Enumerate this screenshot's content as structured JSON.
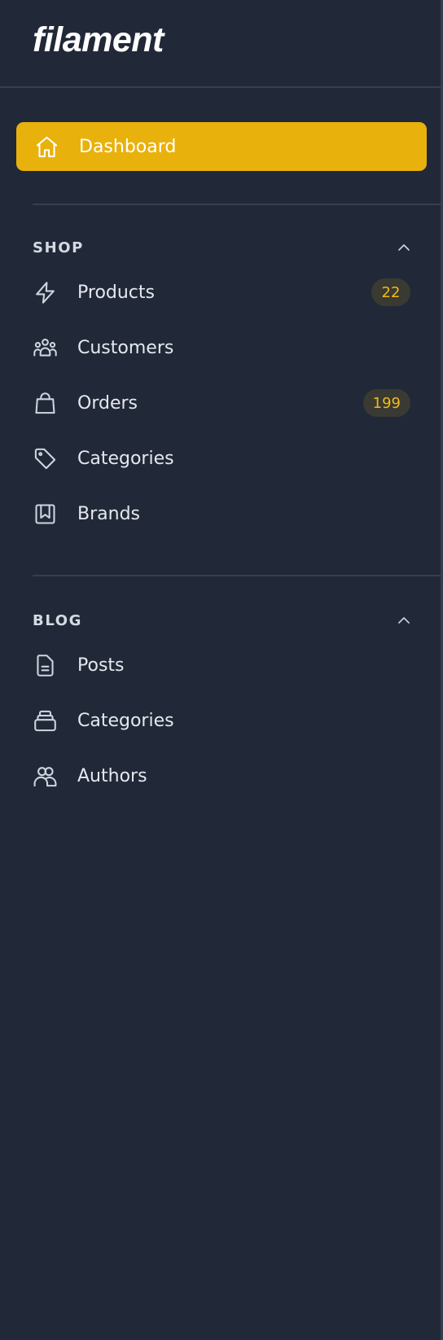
{
  "brand": {
    "logo_text": "filament"
  },
  "nav": {
    "dashboard": {
      "label": "Dashboard",
      "icon": "home-icon",
      "active": true,
      "accent": "#e9b10c"
    },
    "groups": [
      {
        "label": "SHOP",
        "collapse_icon": "chevron-up-icon",
        "items": [
          {
            "label": "Products",
            "icon": "bolt-icon",
            "badge": "22"
          },
          {
            "label": "Customers",
            "icon": "user-group-icon"
          },
          {
            "label": "Orders",
            "icon": "shopping-bag-icon",
            "badge": "199"
          },
          {
            "label": "Categories",
            "icon": "tag-icon"
          },
          {
            "label": "Brands",
            "icon": "bookmark-square-icon"
          }
        ]
      },
      {
        "label": "BLOG",
        "collapse_icon": "chevron-up-icon",
        "items": [
          {
            "label": "Posts",
            "icon": "document-text-icon"
          },
          {
            "label": "Categories",
            "icon": "rectangle-stack-icon"
          },
          {
            "label": "Authors",
            "icon": "users-icon"
          }
        ]
      }
    ]
  },
  "colors": {
    "background": "#212938",
    "badge_text": "#f1bb17",
    "badge_bg": "#3a3a33",
    "divider": "#373f4f"
  }
}
